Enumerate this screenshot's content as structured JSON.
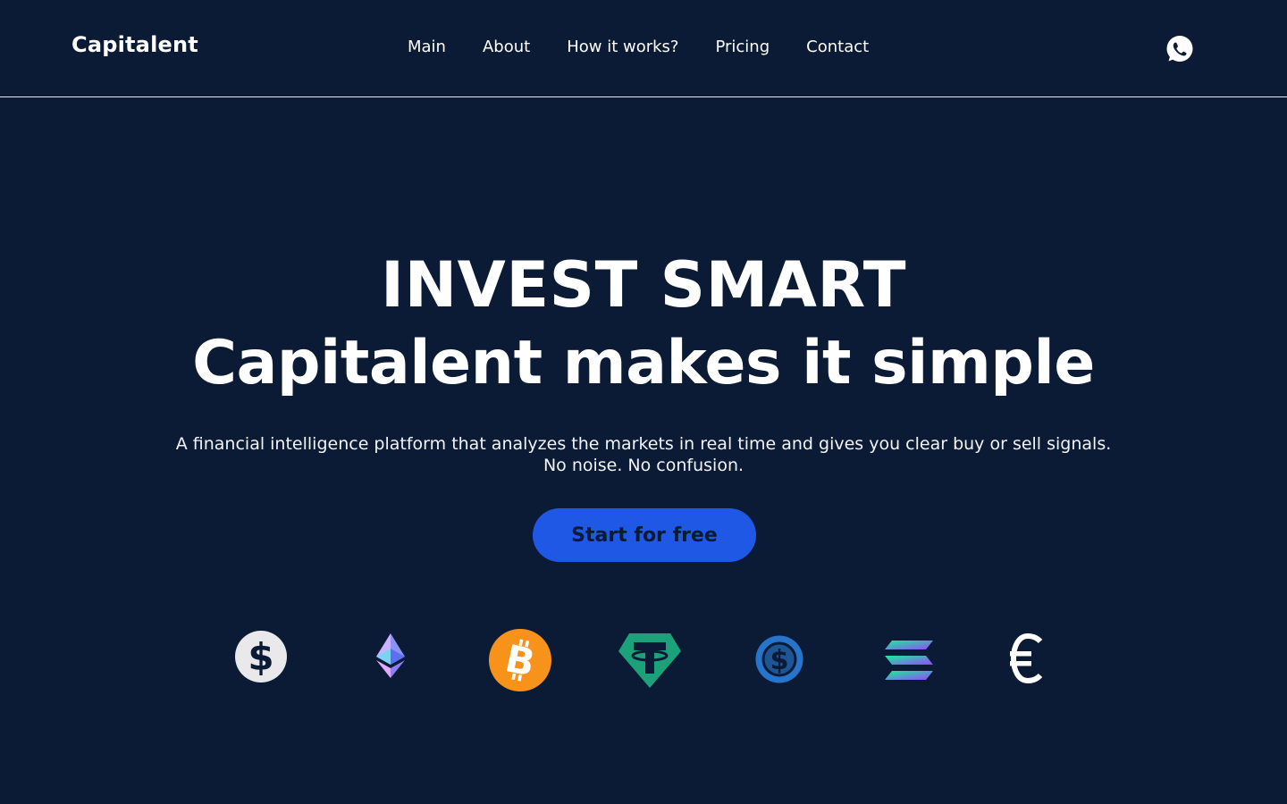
{
  "header": {
    "brand": "Capitalent",
    "nav": [
      {
        "label": "Main"
      },
      {
        "label": "About"
      },
      {
        "label": "How it works?"
      },
      {
        "label": "Pricing"
      },
      {
        "label": "Contact"
      }
    ],
    "contact_icon": "whatsapp-icon"
  },
  "hero": {
    "title_line1": "INVEST SMART",
    "title_line2": "Capitalent makes it simple",
    "subtitle_line1": "A financial intelligence platform that analyzes the markets in real time and gives you clear buy or sell signals.",
    "subtitle_line2": "No noise. No confusion.",
    "cta_label": "Start for free"
  },
  "currencies": [
    {
      "icon": "dollar-icon",
      "color": "#e9e9ec"
    },
    {
      "icon": "ethereum-icon",
      "color": "#8a92f5"
    },
    {
      "icon": "bitcoin-icon",
      "color": "#f7931a"
    },
    {
      "icon": "tether-icon",
      "color": "#1ba27a"
    },
    {
      "icon": "usd-coin-icon",
      "color": "#2775ca"
    },
    {
      "icon": "solana-icon",
      "color": "#14f195"
    },
    {
      "icon": "euro-icon",
      "color": "#ffffff"
    }
  ],
  "colors": {
    "background": "#0b1b35",
    "accent": "#2058e6",
    "text": "#ffffff"
  }
}
